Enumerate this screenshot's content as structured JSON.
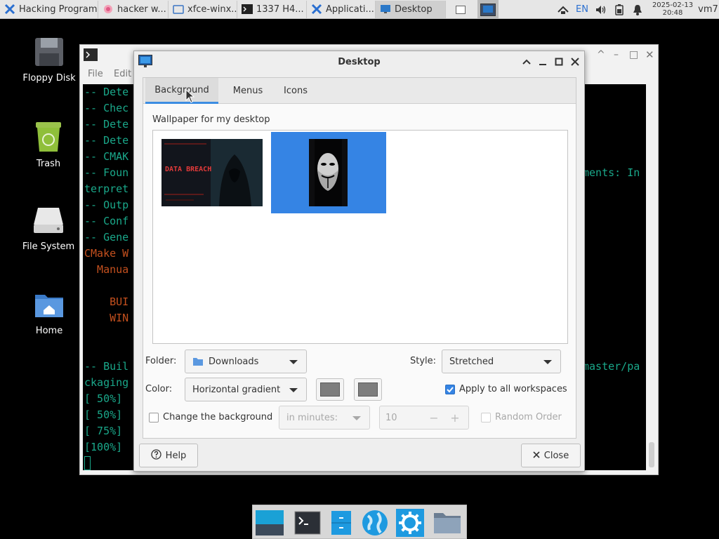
{
  "top_panel": {
    "tasks": [
      {
        "label": "Hacking Programs ≡"
      },
      {
        "label": "hacker w..."
      },
      {
        "label": "xfce-winx..."
      },
      {
        "label": "1337 H4..."
      },
      {
        "label": "Applicati..."
      },
      {
        "label": "Desktop"
      }
    ],
    "lang": "EN",
    "clock_date": "2025-02-13",
    "clock_time": "20:48",
    "hostname": "vm7"
  },
  "desktop_icons": [
    {
      "label": "Floppy Disk"
    },
    {
      "label": "Trash"
    },
    {
      "label": "File System"
    },
    {
      "label": "Home"
    }
  ],
  "terminal": {
    "menu_file": "File",
    "menu_edit": "Edit",
    "lines": [
      "-- Dete",
      "-- Chec",
      "-- Dete",
      "-- Dete",
      "-- CMAK",
      "-- Foun",
      "terpret",
      "-- Outp",
      "-- Conf",
      "-- Gene",
      "CMake W",
      "  Manua",
      "",
      "    BUI",
      "    WIN",
      "",
      "",
      "-- Buil",
      "ckaging",
      "[ 50%] ",
      "[ 50%] ",
      "[ 75%] ",
      "[100%] "
    ],
    "right_fragment_1": "ments: In",
    "right_fragment_2": "master/pa"
  },
  "dialog": {
    "title": "Desktop",
    "tabs": [
      {
        "label": "Background"
      },
      {
        "label": "Menus"
      },
      {
        "label": "Icons"
      }
    ],
    "section_label": "Wallpaper for my desktop",
    "thumb1_text": "DATA BREACH",
    "folder_label": "Folder:",
    "folder_value": "Downloads",
    "style_label": "Style:",
    "style_value": "Stretched",
    "color_label": "Color:",
    "color_value": "Horizontal gradient",
    "apply_all_label": "Apply to all workspaces",
    "apply_all_checked": true,
    "change_bg_label": "Change the background",
    "change_bg_checked": false,
    "interval_value": "in minutes:",
    "interval_number": "10",
    "random_order_label": "Random Order",
    "help_label": "Help",
    "close_label": "Close"
  },
  "colors": {
    "accent": "#3584e4",
    "terminal_green": "#1aa88a",
    "terminal_orange": "#c4501e"
  }
}
